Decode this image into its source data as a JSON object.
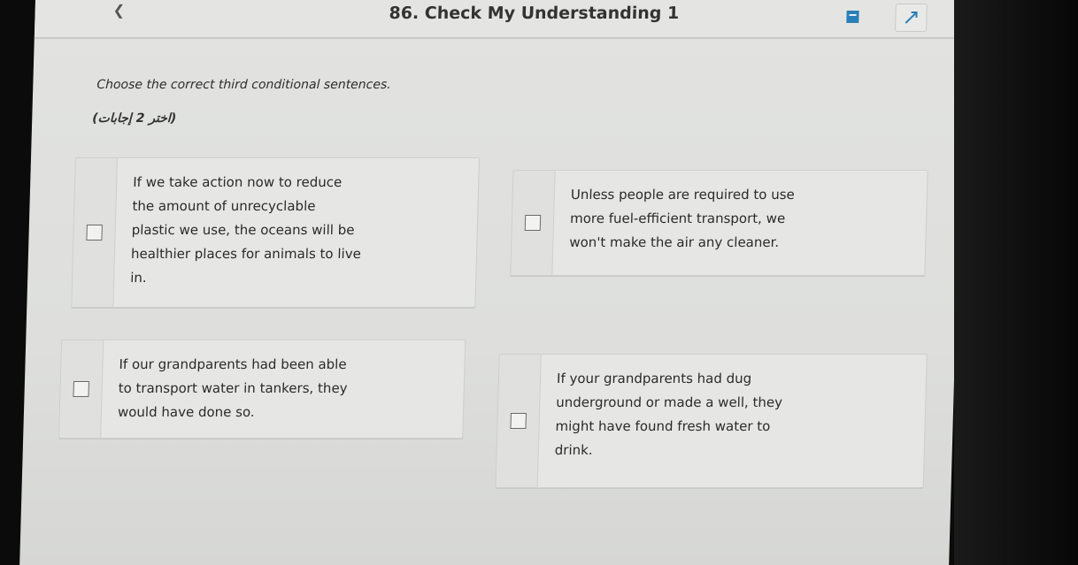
{
  "header": {
    "back_icon": "chevron-left-icon",
    "back_label": "",
    "title": "86. Check My Understanding 1",
    "flag_icon": "bookmark-icon",
    "expand_icon": "expand-arrow-icon"
  },
  "main": {
    "instruction": "Choose the correct third conditional sentences.",
    "hint": "(اختر 2 إجابات)"
  },
  "options": [
    {
      "text": "If we take action now to reduce\nthe amount of unrecyclable\nplastic we use, the oceans will be\nhealthier places for animals to live\nin.",
      "checked": false
    },
    {
      "text": "Unless people are required to use\nmore fuel-efficient transport, we\nwon't make the air any cleaner.",
      "checked": false
    },
    {
      "text": "If our grandparents had been able\nto transport water in tankers, they\nwould have done so.",
      "checked": false
    },
    {
      "text": "If your grandparents had dug\nunderground or made a well, they\nmight have found fresh water to\ndrink.",
      "checked": false
    }
  ],
  "colors": {
    "accent": "#2b7fb8",
    "background": "#e2e3e1"
  }
}
